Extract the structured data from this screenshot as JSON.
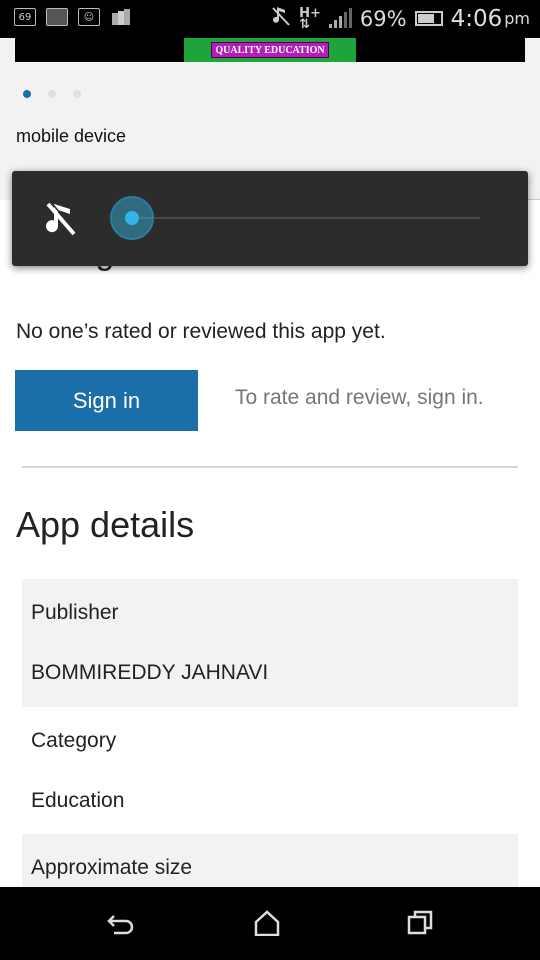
{
  "status_bar": {
    "notification_icons": [
      "sixty-nine-icon",
      "image-icon",
      "smiley-icon",
      "cards-icon"
    ],
    "notif_badge": "69",
    "battery": "69%",
    "time": "4:06",
    "ampm": "pm",
    "network": "H+"
  },
  "banner": {
    "label": "QUALITY EDUCATION"
  },
  "carousel": {
    "count": 3,
    "active": 0
  },
  "device_label": "mobile device",
  "ratings": {
    "heading": "Ratings and reviews",
    "empty_text": "No one’s rated or reviewed this app yet.",
    "sign_in_label": "Sign in",
    "sign_in_hint": "To rate and review, sign in."
  },
  "details": {
    "heading": "App details",
    "publisher_label": "Publisher",
    "publisher_value": "BOMMIREDDY JAHNAVI",
    "category_label": "Category",
    "category_value": "Education",
    "size_label": "Approximate size"
  },
  "volume": {
    "level": 0.0,
    "icon": "music-muted-icon"
  },
  "nav": {
    "icons": [
      "back-icon",
      "home-icon",
      "recents-icon"
    ]
  },
  "colors": {
    "accent": "#1b6fa8",
    "volume_accent": "#33b5e5"
  }
}
